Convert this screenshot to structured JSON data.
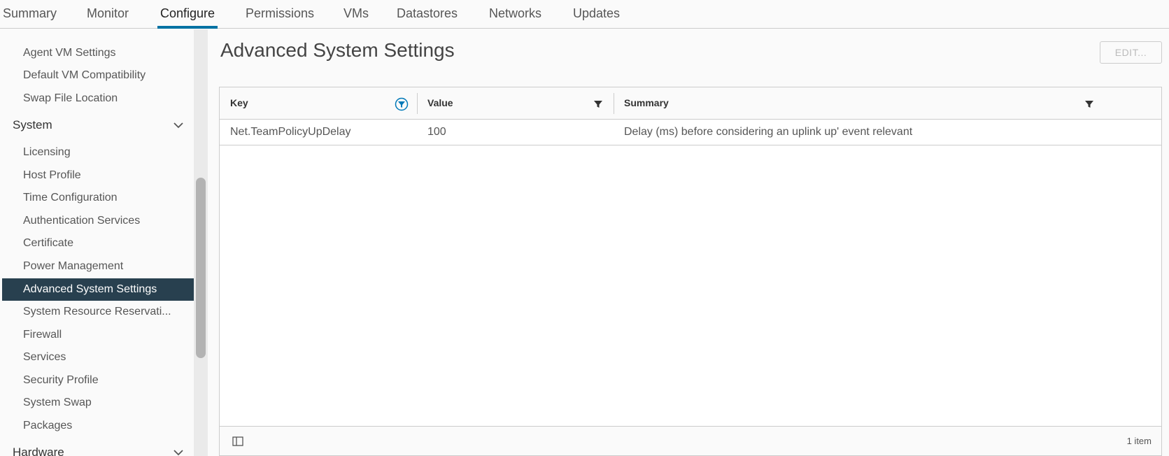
{
  "tabs": [
    "Summary",
    "Monitor",
    "Configure",
    "Permissions",
    "VMs",
    "Datastores",
    "Networks",
    "Updates"
  ],
  "active_tab": "Configure",
  "sidebar": {
    "items_top": [
      "Agent VM Settings",
      "Default VM Compatibility",
      "Swap File Location"
    ],
    "group_system": "System",
    "system_items": [
      "Licensing",
      "Host Profile",
      "Time Configuration",
      "Authentication Services",
      "Certificate",
      "Power Management",
      "Advanced System Settings",
      "System Resource Reservati...",
      "Firewall",
      "Services",
      "Security Profile",
      "System Swap",
      "Packages"
    ],
    "selected": "Advanced System Settings",
    "group_hardware": "Hardware"
  },
  "main": {
    "title": "Advanced System Settings",
    "edit_label": "EDIT..."
  },
  "grid": {
    "columns": [
      "Key",
      "Value",
      "Summary"
    ],
    "rows": [
      {
        "key": "Net.TeamPolicyUpDelay",
        "value": "100",
        "summary": "Delay (ms) before considering an uplink up' event relevant"
      }
    ],
    "footer_count": "1 item"
  },
  "colors": {
    "accent": "#0072a3",
    "selected_bg": "#28404f",
    "filter_active": "#0079b8"
  }
}
